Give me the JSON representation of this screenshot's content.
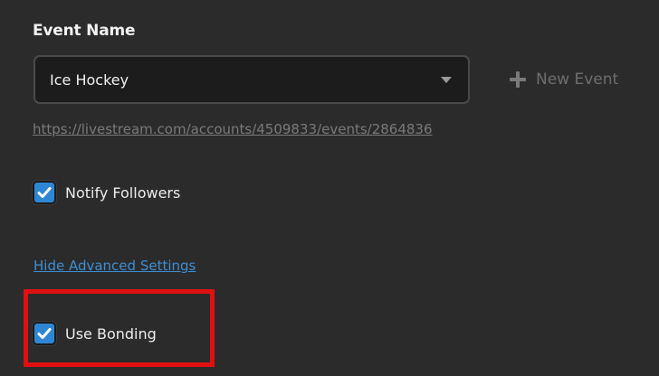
{
  "event": {
    "section_title": "Event Name",
    "selected_event": "Ice Hockey",
    "new_event_label": "New Event",
    "url": "https://livestream.com/accounts/4509833/events/2864836"
  },
  "options": {
    "notify_followers": {
      "label": "Notify Followers",
      "checked": true
    },
    "advanced_link": "Hide Advanced Settings",
    "use_bonding": {
      "label": "Use Bonding",
      "checked": true
    }
  },
  "icons": {
    "dropdown": "chevron-down-icon",
    "new_event": "plus-icon",
    "checkbox": "checkmark-icon"
  },
  "colors": {
    "background": "#2b2b2b",
    "checkbox_accent": "#2f86d3",
    "link": "#3d8fd6",
    "highlight": "#e01010"
  }
}
